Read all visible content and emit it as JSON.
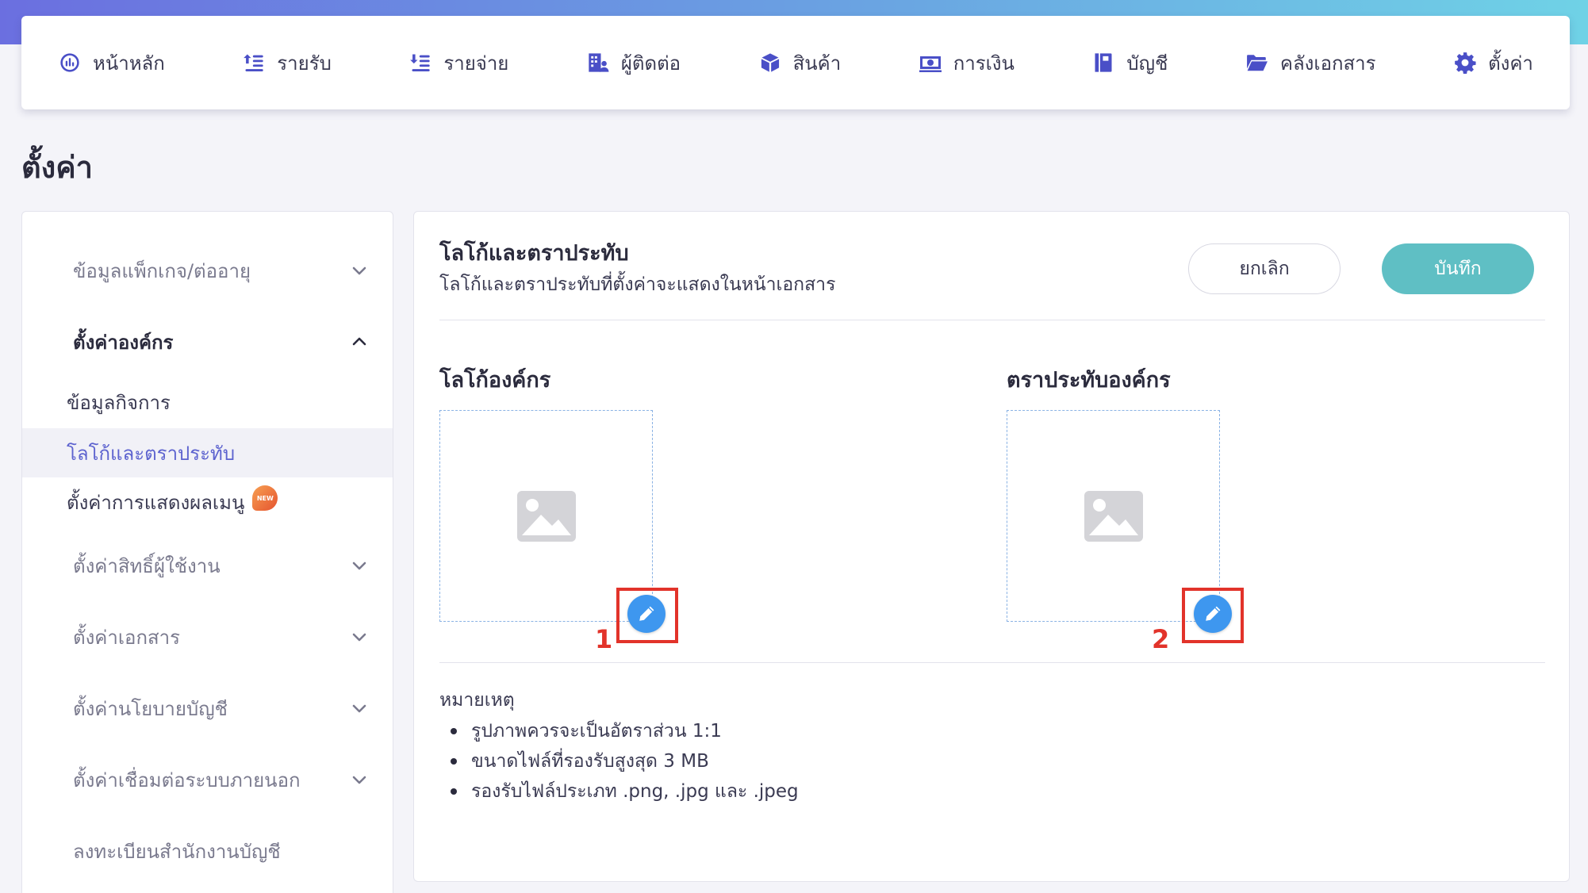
{
  "colors": {
    "accent": "#5d63cf",
    "save": "#5fbfc4",
    "edit": "#3e97ef",
    "highlight": "#e2332a"
  },
  "nav": [
    {
      "label": "หน้าหลัก",
      "icon": "dashboard-icon"
    },
    {
      "label": "รายรับ",
      "icon": "income-icon"
    },
    {
      "label": "รายจ่าย",
      "icon": "expense-icon"
    },
    {
      "label": "ผู้ติดต่อ",
      "icon": "contacts-icon"
    },
    {
      "label": "สินค้า",
      "icon": "box-icon"
    },
    {
      "label": "การเงิน",
      "icon": "money-icon"
    },
    {
      "label": "บัญชี",
      "icon": "book-icon"
    },
    {
      "label": "คลังเอกสาร",
      "icon": "folder-icon"
    },
    {
      "label": "ตั้งค่า",
      "icon": "gear-icon"
    }
  ],
  "page_title": "ตั้งค่า",
  "sidebar": {
    "groups": [
      {
        "label": "ข้อมูลแพ็กเกจ/ต่ออายุ",
        "open": false
      },
      {
        "label": "ตั้งค่าองค์กร",
        "open": true
      },
      {
        "label": "ตั้งค่าสิทธิ์ผู้ใช้งาน",
        "open": false
      },
      {
        "label": "ตั้งค่าเอกสาร",
        "open": false
      },
      {
        "label": "ตั้งค่านโยบายบัญชี",
        "open": false
      },
      {
        "label": "ตั้งค่าเชื่อมต่อระบบภายนอก",
        "open": false
      },
      {
        "label": "ลงทะเบียนสำนักงานบัญชี",
        "open": false
      }
    ],
    "sub_items": [
      {
        "label": "ข้อมูลกิจการ",
        "active": false
      },
      {
        "label": "โลโก้และตราประทับ",
        "active": true
      },
      {
        "label": "ตั้งค่าการแสดงผลเมนู",
        "active": false,
        "badge": "NEW"
      }
    ]
  },
  "main": {
    "title": "โลโก้และตราประทับ",
    "subtitle": "โลโก้และตราประทับที่ตั้งค่าจะแสดงในหน้าเอกสาร",
    "cancel_label": "ยกเลิก",
    "save_label": "บันทึก",
    "logo_title": "โลโก้องค์กร",
    "stamp_title": "ตราประทับองค์กร",
    "step_1": "1",
    "step_2": "2",
    "note_title": "หมายเหตุ",
    "notes": [
      "รูปภาพควรจะเป็นอัตราส่วน 1:1",
      "ขนาดไฟล์ที่รองรับสูงสุด 3 MB",
      "รองรับไฟล์ประเภท .png, .jpg และ .jpeg"
    ]
  }
}
